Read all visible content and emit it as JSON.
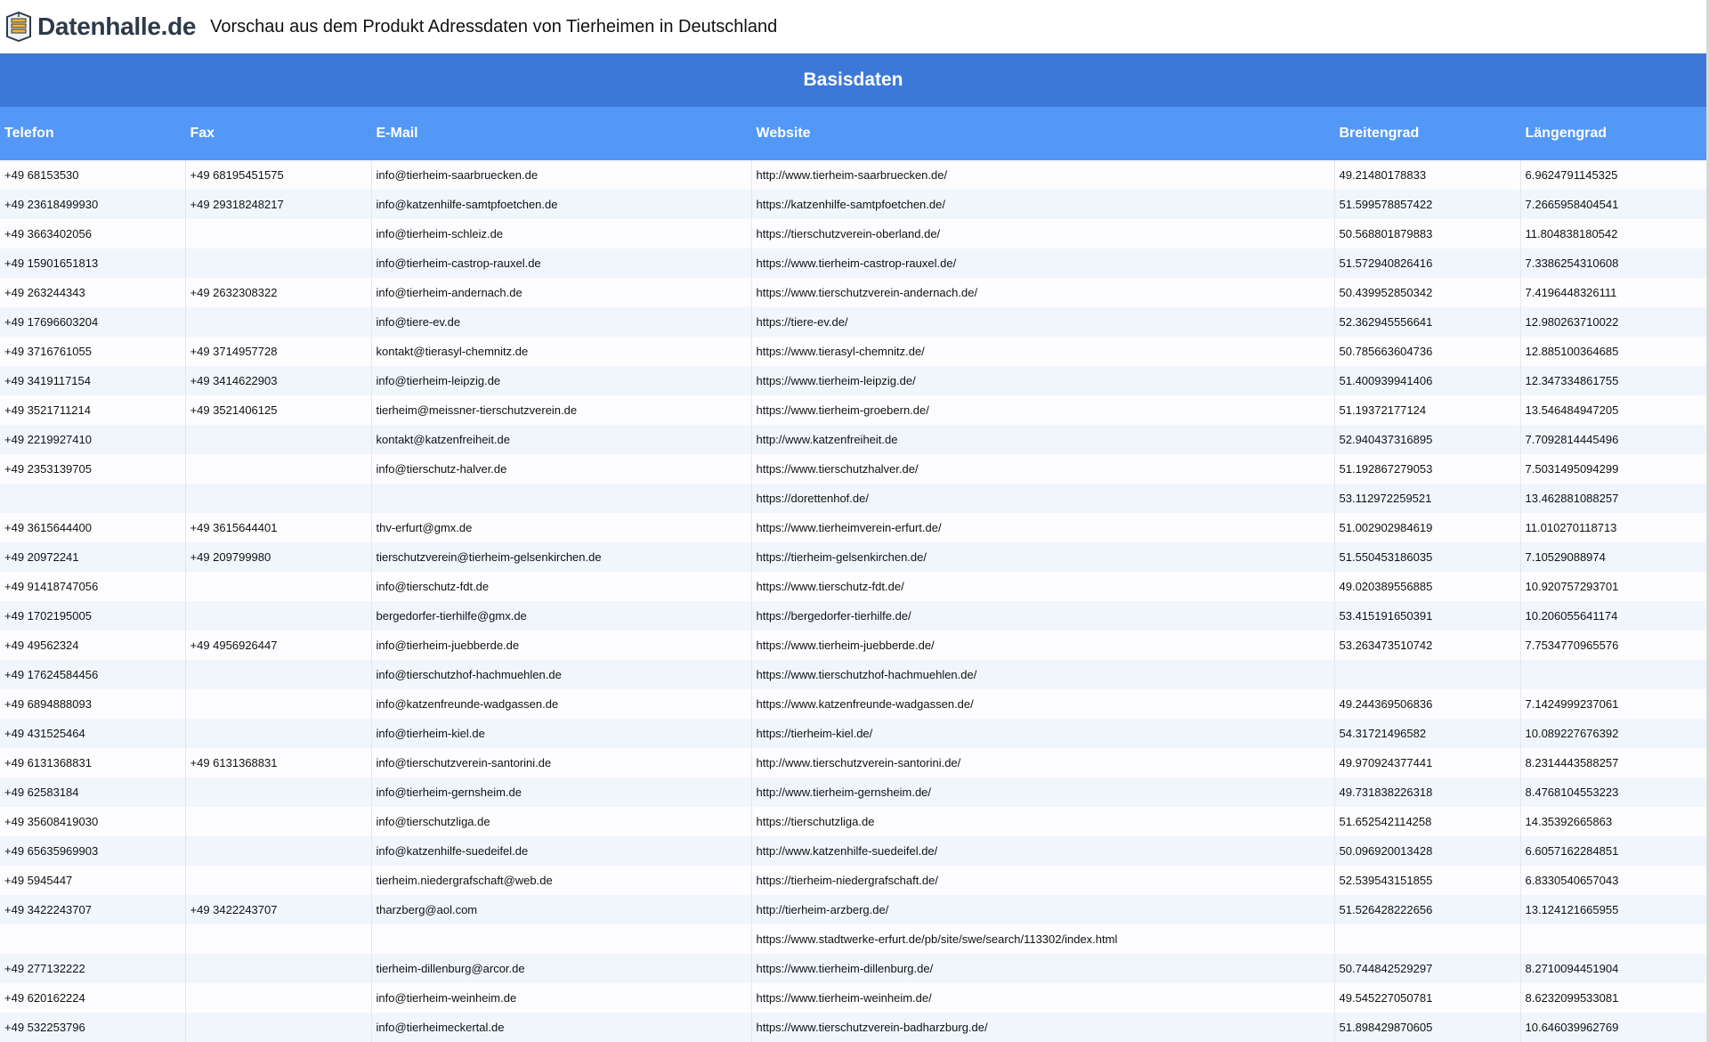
{
  "header": {
    "logo_text": "Datenhalle.de",
    "title": "Vorschau aus dem Produkt Adressdaten von Tierheimen in Deutschland"
  },
  "section": {
    "title": "Basisdaten"
  },
  "colors": {
    "section_bg": "#3c78d8",
    "header_bg": "#5498f7",
    "row_alt": "#f1f6fd"
  },
  "table": {
    "columns": [
      "Telefon",
      "Fax",
      "E-Mail",
      "Website",
      "Breitengrad",
      "Längengrad"
    ],
    "rows": [
      [
        "+49 68153530",
        "+49 68195451575",
        "info@tierheim-saarbruecken.de",
        "http://www.tierheim-saarbruecken.de/",
        "49.21480178833",
        "6.9624791145325"
      ],
      [
        "+49 23618499930",
        "+49 29318248217",
        "info@katzenhilfe-samtpfoetchen.de",
        "https://katzenhilfe-samtpfoetchen.de/",
        "51.599578857422",
        "7.2665958404541"
      ],
      [
        "+49 3663402056",
        "",
        "info@tierheim-schleiz.de",
        "https://tierschutzverein-oberland.de/",
        "50.568801879883",
        "11.804838180542"
      ],
      [
        "+49 15901651813",
        "",
        "info@tierheim-castrop-rauxel.de",
        "https://www.tierheim-castrop-rauxel.de/",
        "51.572940826416",
        "7.3386254310608"
      ],
      [
        "+49 263244343",
        "+49 2632308322",
        "info@tierheim-andernach.de",
        "https://www.tierschutzverein-andernach.de/",
        "50.439952850342",
        "7.4196448326111"
      ],
      [
        "+49 17696603204",
        "",
        "info@tiere-ev.de",
        "https://tiere-ev.de/",
        "52.362945556641",
        "12.980263710022"
      ],
      [
        "+49 3716761055",
        "+49 3714957728",
        "kontakt@tierasyl-chemnitz.de",
        "https://www.tierasyl-chemnitz.de/",
        "50.785663604736",
        "12.885100364685"
      ],
      [
        "+49 3419117154",
        "+49 3414622903",
        "info@tierheim-leipzig.de",
        "https://www.tierheim-leipzig.de/",
        "51.400939941406",
        "12.347334861755"
      ],
      [
        "+49 3521711214",
        "+49 3521406125",
        "tierheim@meissner-tierschutzverein.de",
        "https://www.tierheim-groebern.de/",
        "51.19372177124",
        "13.546484947205"
      ],
      [
        "+49 2219927410",
        "",
        "kontakt@katzenfreiheit.de",
        "http://www.katzenfreiheit.de",
        "52.940437316895",
        "7.7092814445496"
      ],
      [
        "+49 2353139705",
        "",
        "info@tierschutz-halver.de",
        "https://www.tierschutzhalver.de/",
        "51.192867279053",
        "7.5031495094299"
      ],
      [
        "",
        "",
        "",
        "https://dorettenhof.de/",
        "53.112972259521",
        "13.462881088257"
      ],
      [
        "+49 3615644400",
        "+49 3615644401",
        "thv-erfurt@gmx.de",
        "https://www.tierheimverein-erfurt.de/",
        "51.002902984619",
        "11.010270118713"
      ],
      [
        "+49 20972241",
        "+49 209799980",
        "tierschutzverein@tierheim-gelsenkirchen.de",
        "https://tierheim-gelsenkirchen.de/",
        "51.550453186035",
        "7.10529088974"
      ],
      [
        "+49 91418747056",
        "",
        "info@tierschutz-fdt.de",
        "https://www.tierschutz-fdt.de/",
        "49.020389556885",
        "10.920757293701"
      ],
      [
        "+49 1702195005",
        "",
        "bergedorfer-tierhilfe@gmx.de",
        "https://bergedorfer-tierhilfe.de/",
        "53.415191650391",
        "10.206055641174"
      ],
      [
        "+49 49562324",
        "+49 4956926447",
        "info@tierheim-juebberde.de",
        "https://www.tierheim-juebberde.de/",
        "53.263473510742",
        "7.7534770965576"
      ],
      [
        "+49 17624584456",
        "",
        "info@tierschutzhof-hachmuehlen.de",
        "https://www.tierschutzhof-hachmuehlen.de/",
        "",
        ""
      ],
      [
        "+49 6894888093",
        "",
        "info@katzenfreunde-wadgassen.de",
        "https://www.katzenfreunde-wadgassen.de/",
        "49.244369506836",
        "7.1424999237061"
      ],
      [
        "+49 431525464",
        "",
        "info@tierheim-kiel.de",
        "https://tierheim-kiel.de/",
        "54.31721496582",
        "10.089227676392"
      ],
      [
        "+49 6131368831",
        "+49 6131368831",
        "info@tierschutzverein-santorini.de",
        "http://www.tierschutzverein-santorini.de/",
        "49.970924377441",
        "8.2314443588257"
      ],
      [
        "+49 62583184",
        "",
        "info@tierheim-gernsheim.de",
        "http://www.tierheim-gernsheim.de/",
        "49.731838226318",
        "8.4768104553223"
      ],
      [
        "+49 35608419030",
        "",
        "info@tierschutzliga.de",
        "https://tierschutzliga.de",
        "51.652542114258",
        "14.35392665863"
      ],
      [
        "+49 65635969903",
        "",
        "info@katzenhilfe-suedeifel.de",
        "http://www.katzenhilfe-suedeifel.de/",
        "50.096920013428",
        "6.6057162284851"
      ],
      [
        "+49 5945447",
        "",
        "tierheim.niedergrafschaft@web.de",
        "https://tierheim-niedergrafschaft.de/",
        "52.539543151855",
        "6.8330540657043"
      ],
      [
        "+49 3422243707",
        "+49 3422243707",
        "tharzberg@aol.com",
        "http://tierheim-arzberg.de/",
        "51.526428222656",
        "13.124121665955"
      ],
      [
        "",
        "",
        "",
        "https://www.stadtwerke-erfurt.de/pb/site/swe/search/113302/index.html",
        "",
        ""
      ],
      [
        "+49 277132222",
        "",
        "tierheim-dillenburg@arcor.de",
        "https://www.tierheim-dillenburg.de/",
        "50.744842529297",
        "8.2710094451904"
      ],
      [
        "+49 620162224",
        "",
        "info@tierheim-weinheim.de",
        "https://www.tierheim-weinheim.de/",
        "49.545227050781",
        "8.6232099533081"
      ],
      [
        "+49 532253796",
        "",
        "info@tierheimeckertal.de",
        "https://www.tierschutzverein-badharzburg.de/",
        "51.898429870605",
        "10.646039962769"
      ]
    ]
  }
}
